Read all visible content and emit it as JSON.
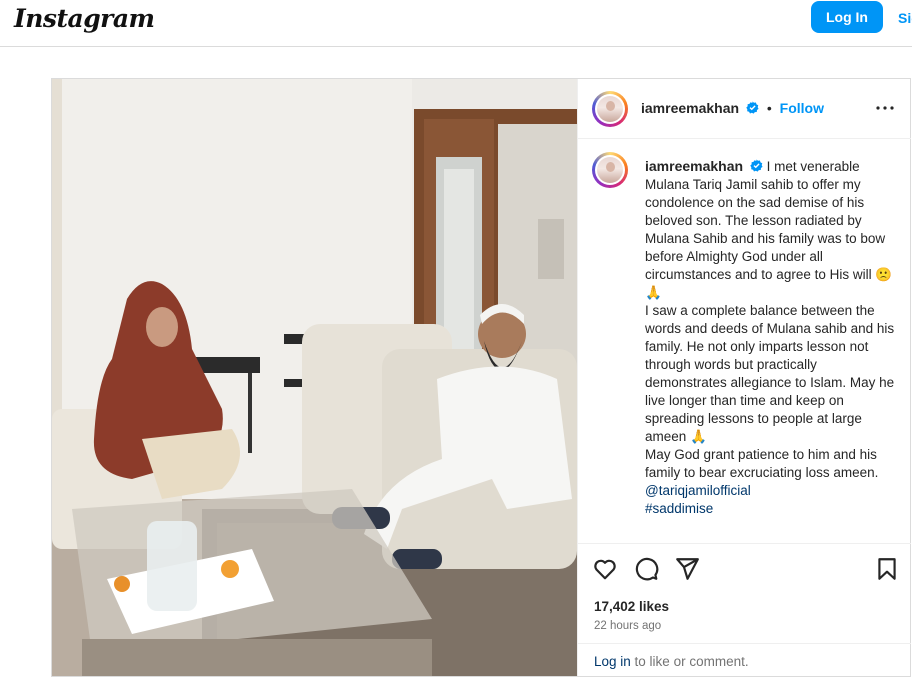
{
  "brand": {
    "logo_text": "Instagram"
  },
  "nav": {
    "login_label": "Log In",
    "signup_label": "Sign Up"
  },
  "post": {
    "username": "iamreemakhan",
    "follow_label": "Follow",
    "dot": "•",
    "caption": {
      "p1": "I met venerable Mulana Tariq Jamil sahib to offer my condolence on the sad demise of his beloved son. The lesson radiated by Mulana Sahib and his family was to bow before Almighty God under all circumstances and to agree to His will",
      "p1_emoji": "🙁🙏",
      "p2": "I saw a complete balance between the words and deeds of Mulana sahib and his family. He not only imparts lesson not through words but practically demonstrates allegiance to Islam. May he live longer than time and keep on spreading lessons to people at large ameen",
      "p2_emoji": "🙏",
      "p3": "May God grant patience to him and his family to bear excruciating loss ameen.",
      "mention": "@tariqjamilofficial",
      "hashtag": "#saddimise"
    },
    "likes": "17,402 likes",
    "time": "22 hours ago",
    "footer": {
      "login_link": "Log in",
      "rest": " to like or comment."
    }
  },
  "colors": {
    "accent": "#0095f6",
    "link": "#00376b",
    "verified": "#0095f6"
  },
  "icons": [
    "more-icon",
    "heart-icon",
    "comment-icon",
    "share-icon",
    "bookmark-icon",
    "verified-badge-icon"
  ]
}
